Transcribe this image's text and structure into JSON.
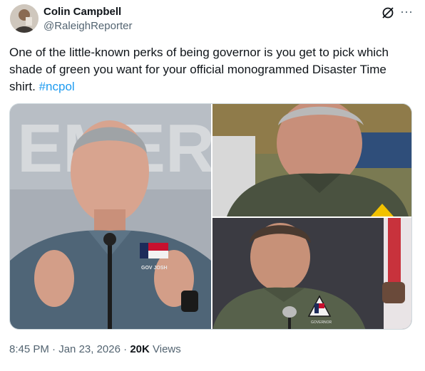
{
  "author": {
    "name": "Colin Campbell",
    "handle": "@RaleighReporter"
  },
  "post": {
    "text": "One of the little-known perks of being governor is you get to pick which shade of green you want for your official monogrammed Disaster Time shirt.",
    "hashtag": "#ncpol"
  },
  "media": {
    "photo1_sign": "EMERG",
    "photo1_badge": "GOV JOSH",
    "photo3_badge": "GOVERNOR"
  },
  "meta": {
    "time": "8:45 PM",
    "date": "Jan 23, 2026",
    "separator": "·",
    "views_count": "20K",
    "views_label": "Views"
  },
  "icons": {
    "grok": "grok-icon",
    "more": "more-icon"
  },
  "colors": {
    "link": "#1d9bf0",
    "secondary_text": "#536471",
    "border": "#cfd9de",
    "shirt_green": "#4a5240"
  }
}
